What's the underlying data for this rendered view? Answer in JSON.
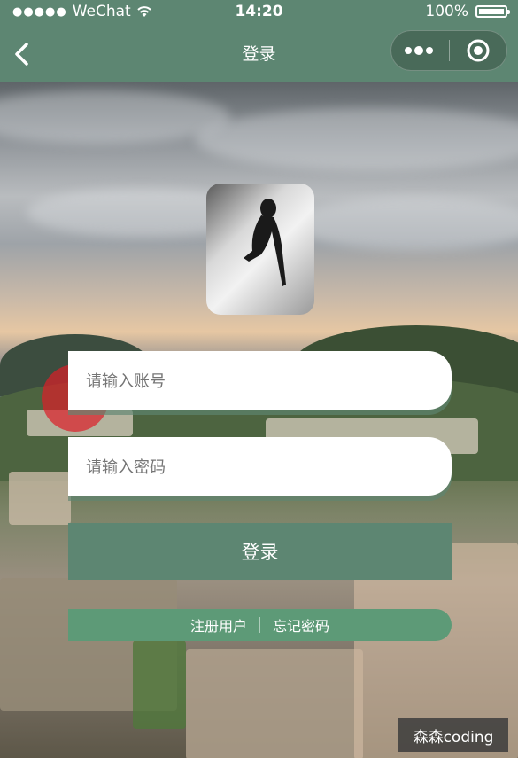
{
  "status_bar": {
    "carrier": "WeChat",
    "time": "14:20",
    "battery": "100%"
  },
  "navbar": {
    "title": "登录",
    "back_icon": "chevron-left-icon",
    "more_icon": "more-dots-icon",
    "close_icon": "target-circle-icon"
  },
  "form": {
    "account_placeholder": "请输入账号",
    "password_placeholder": "请输入密码",
    "login_label": "登录"
  },
  "links": {
    "register": "注册用户",
    "forgot_password": "忘记密码"
  },
  "watermark": "森森coding",
  "colors": {
    "primary": "#5d8672",
    "links_bar": "#5d9a77",
    "field_bg": "#ffffff"
  }
}
